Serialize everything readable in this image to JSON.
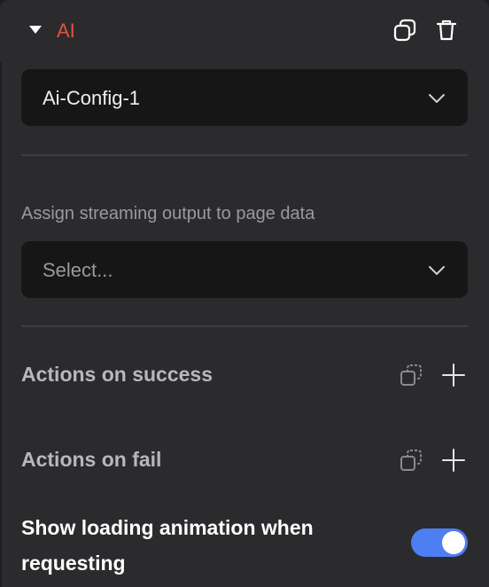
{
  "header": {
    "title": "AI",
    "copy_icon": "copy-icon",
    "delete_icon": "trash-icon",
    "accent_color": "#e0533f"
  },
  "config_select": {
    "value": "Ai-Config-1"
  },
  "streaming": {
    "label": "Assign streaming output to page data",
    "placeholder": "Select..."
  },
  "actions": {
    "success_label": "Actions on success",
    "fail_label": "Actions on fail"
  },
  "loading": {
    "label": "Show loading animation when requesting",
    "enabled": true,
    "toggle_color": "#4d7ef2"
  }
}
